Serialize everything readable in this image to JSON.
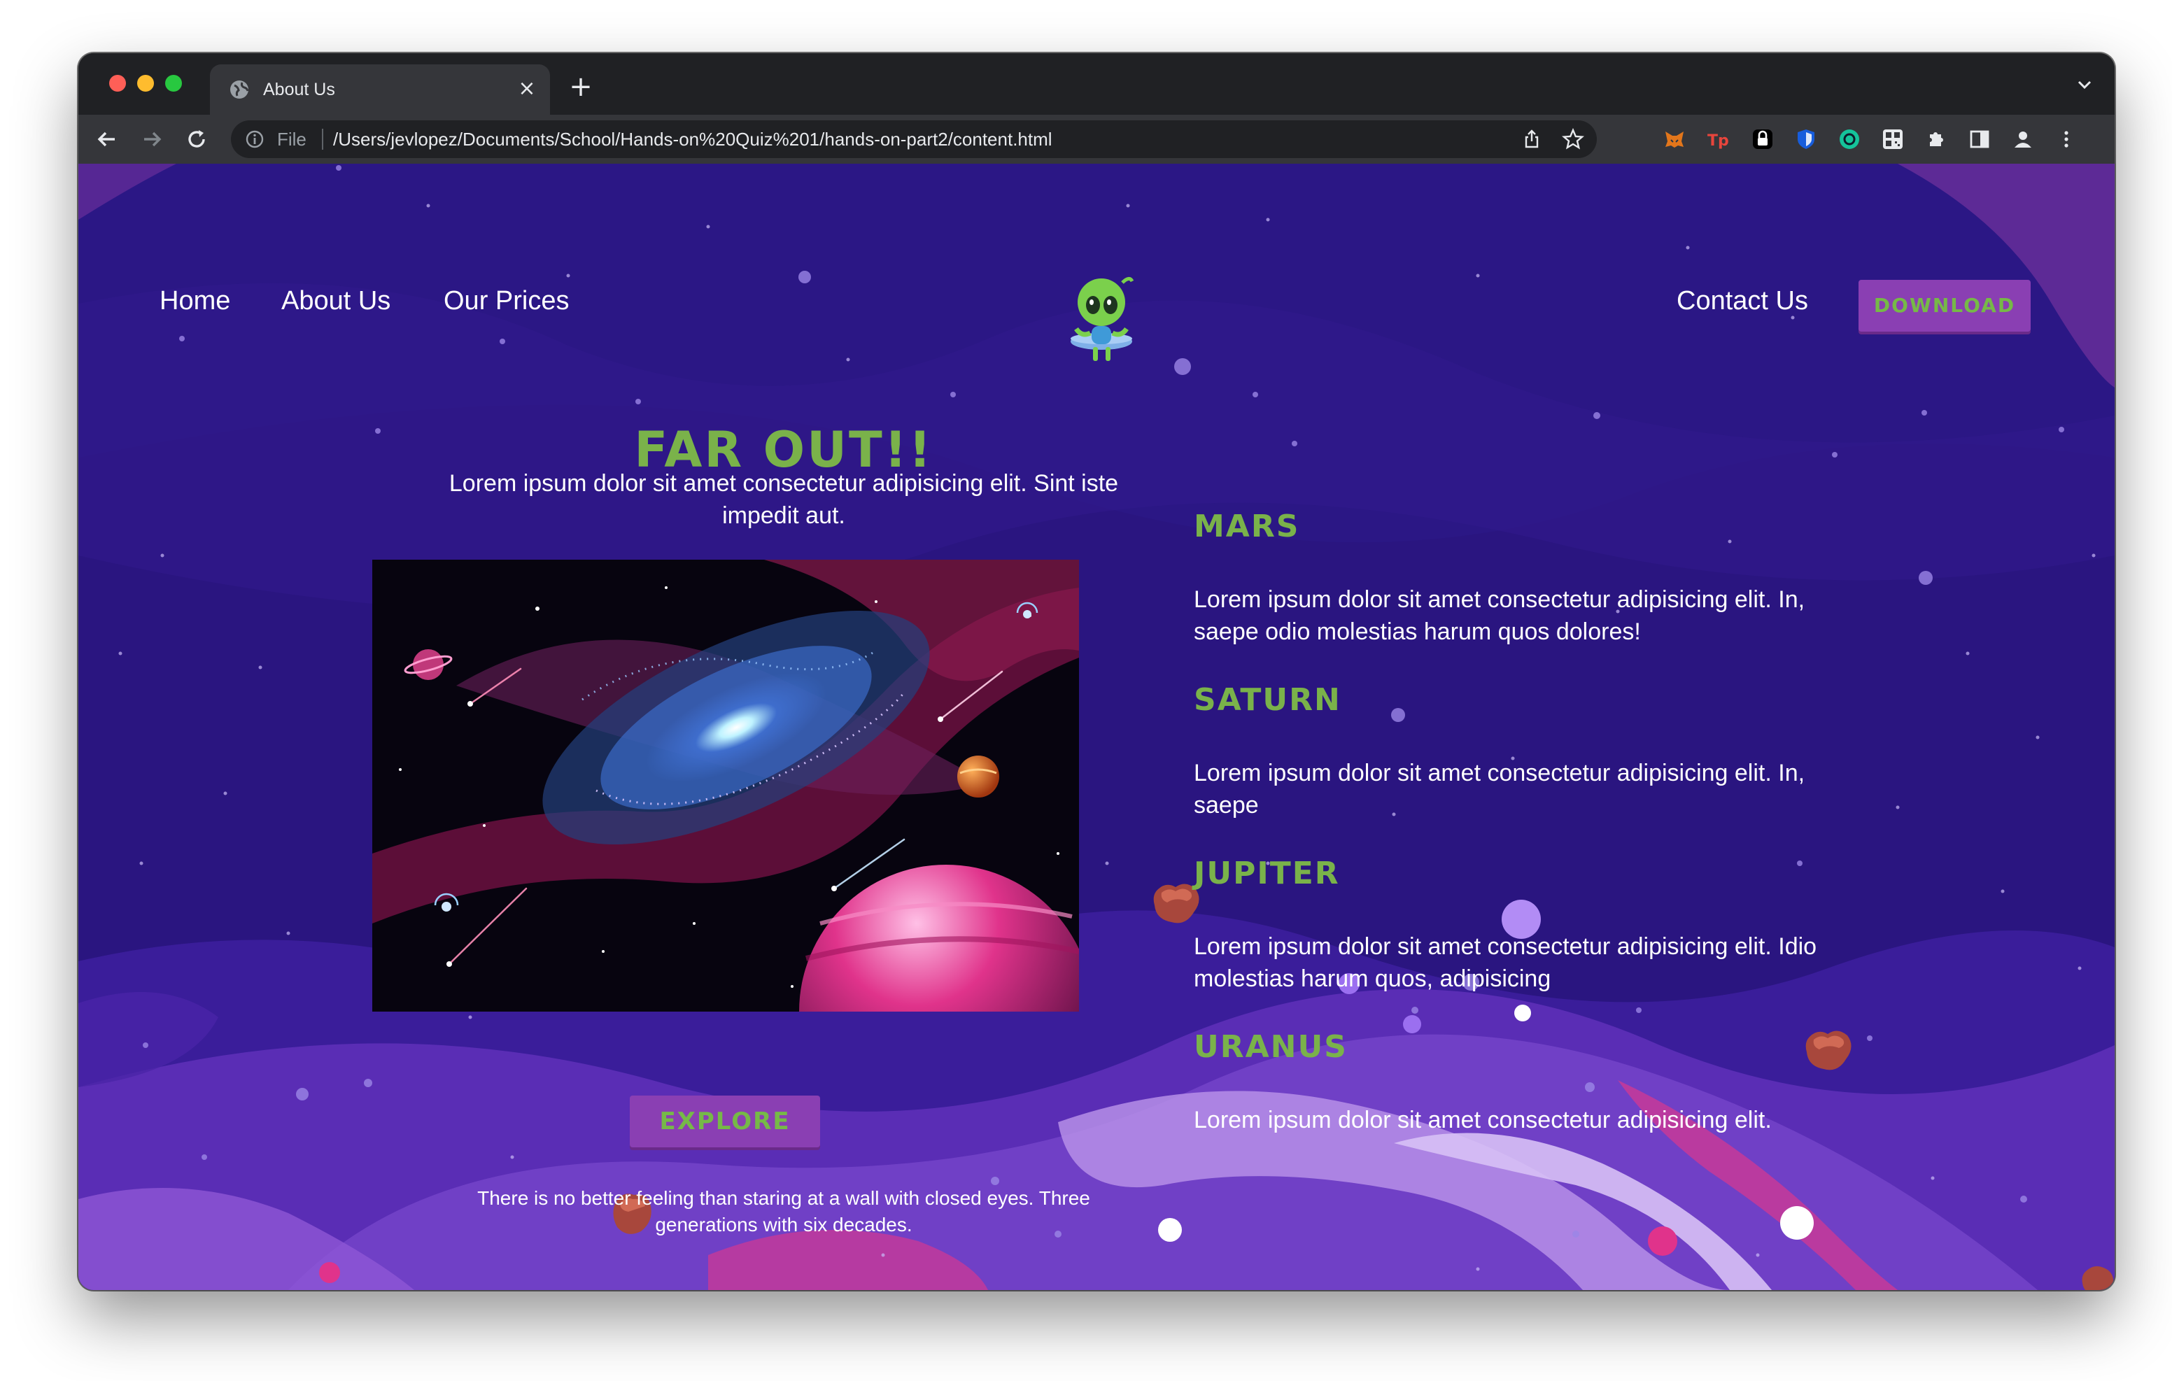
{
  "browser": {
    "tab_title": "About Us",
    "address_scheme_label": "File",
    "address_url": "/Users/jevlopez/Documents/School/Hands-on%20Quiz%201/hands-on-part2/content.html",
    "extensions": [
      "metamask-icon",
      "tp-icon",
      "lock-icon",
      "shield-icon",
      "grammarly-icon",
      "qr-icon",
      "puzzle-icon",
      "sidebar-icon",
      "profile-icon"
    ]
  },
  "nav": {
    "links": [
      "Home",
      "About Us",
      "Our Prices"
    ],
    "contact": "Contact Us",
    "download": "DOWNLOAD"
  },
  "hero": {
    "headline": "FAR OUT!!",
    "lead": "Lorem ipsum dolor sit amet consectetur adipisicing elit. Sint iste impedit aut.",
    "explore": "EXPLORE",
    "footnote": "There is no better feeling than staring at a wall with closed eyes. Three generations with six decades."
  },
  "planets": [
    {
      "name": "MARS",
      "text": "Lorem ipsum dolor sit amet consectetur adipisicing elit. In, saepe odio molestias harum quos dolores!"
    },
    {
      "name": "SATURN",
      "text": "Lorem ipsum dolor sit amet consectetur adipisicing elit. In, saepe"
    },
    {
      "name": "JUPITER",
      "text": "Lorem ipsum dolor sit amet consectetur adipisicing elit. Idio molestias harum quos, adipisicing"
    },
    {
      "name": "URANUS",
      "text": "Lorem ipsum dolor sit amet consectetur adipisicing elit."
    }
  ],
  "colors": {
    "accent_green": "#7ab24a",
    "button_purple": "#8a3fb3",
    "page_background": "#2a1580"
  }
}
